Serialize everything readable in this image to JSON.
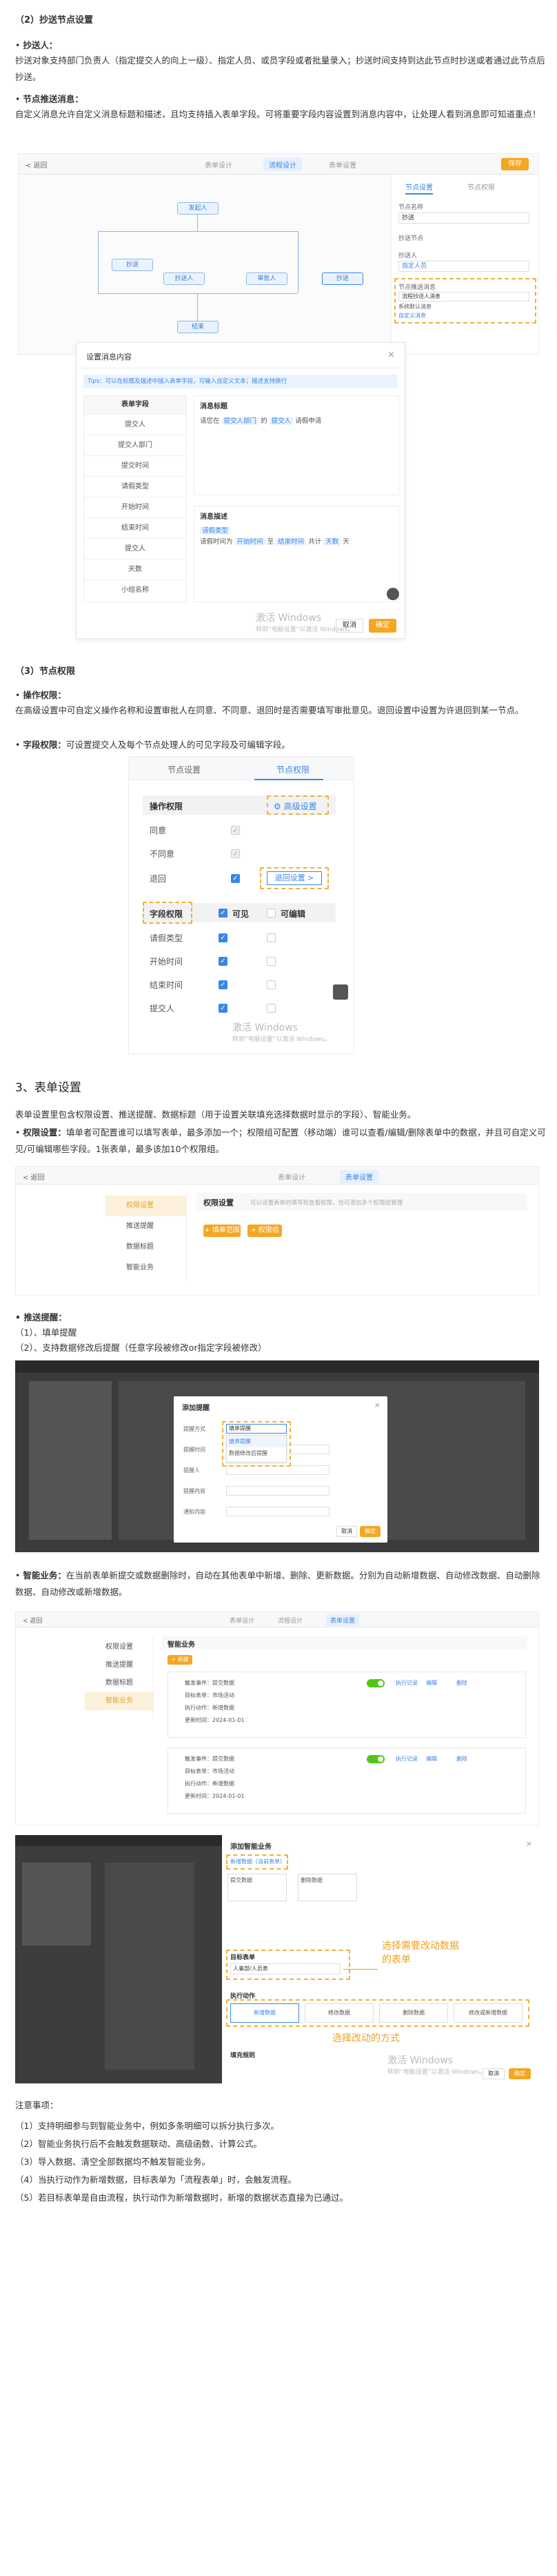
{
  "sec_copy": {
    "title": "（2）抄送节点设置",
    "cc_title": "抄送人：",
    "cc_text": "抄送对象支持部门负责人（指定提交人的向上一级）、指定人员、或员字段或者批量录入；抄送时间支持到达此节点时抄送或者通过此节点后抄送。",
    "push_title": "节点推送消息：",
    "push_text": "自定义消息允许自定义消息标题和描述，且均支持插入表单字段。可将重要字段内容设置到消息内容中，让处理人看到消息即可知道重点！"
  },
  "flow_shot": {
    "back": "< 返回",
    "tabs": [
      "表单设计",
      "流程设计",
      "表单设置"
    ],
    "save": "保存",
    "nodes": [
      "发起人",
      "抄送",
      "抄送人",
      "审批人",
      "结束"
    ],
    "panel_tabs": [
      "节点设置",
      "节点权限"
    ],
    "panel_labels": [
      "节点名称",
      "抄送节点",
      "抄送人",
      "节点推送消息"
    ],
    "panel_values": [
      "抄送",
      "添加",
      "指定人员",
      "流程抄送人消息"
    ],
    "options": [
      "系统默认消息",
      "自定义消息"
    ]
  },
  "msg_dialog": {
    "title": "设置消息内容",
    "tips": "Tips：可以在标题及描述中插入表单字段，可输入自定义文本；描述支持换行",
    "field_header": "表单字段",
    "fields": [
      "提交人",
      "提交人部门",
      "提交时间",
      "请假类型",
      "开始时间",
      "结束时间",
      "提交人",
      "天数",
      "小组名称"
    ],
    "title_label": "消息标题",
    "title_text_1": "请您在",
    "title_chip_1": "提交人部门",
    "title_text_2": "的",
    "title_chip_2": "提交人",
    "title_text_3": "请假申请",
    "desc_label": "消息描述",
    "desc_chip_1": "请假类型",
    "desc_text_1": "请假时间为",
    "desc_chip_2": "开始时间",
    "desc_text_2": "至",
    "desc_chip_3": "结束时间",
    "desc_text_3": "共计",
    "desc_chip_4": "天数",
    "desc_text_4": "天",
    "cancel": "取消",
    "ok": "确定"
  },
  "watermark": {
    "line1": "激活 Windows",
    "line2": "转到“电脑设置”以激活 Windows。"
  },
  "sec_node": {
    "title": "（3）节点权限",
    "op_title": "操作权限：",
    "op_text": "在高级设置中可自定义操作名称和设置审批人在同意、不同意、退回时是否需要填写审批意见。退回设置中设置为许退回到某一节点。",
    "field_title": "字段权限：",
    "field_text": "可设置提交人及每个节点处理人的可见字段及可编辑字段。"
  },
  "perm_shot": {
    "tabs": [
      "节点设置",
      "节点权限"
    ],
    "op_header": "操作权限",
    "adv": "高级设置",
    "ops": [
      "同意",
      "不同意",
      "退回"
    ],
    "back_setting": "退回设置 >",
    "field_header": "字段权限",
    "visible": "可见",
    "editable": "可编辑",
    "fields": [
      "请假类型",
      "开始时间",
      "结束时间",
      "提交人"
    ]
  },
  "sec_form": {
    "title": "3、表单设置",
    "intro": "表单设置里包含权限设置、推送提醒、数据标题（用于设置关联填充选择数据时显示的字段）、智能业务。",
    "perm_title": "权限设置：",
    "perm_text": "填单者可配置谁可以填写表单，最多添加一个；权限组可配置（移动端）谁可以查看/编辑/删除表单中的数据，并且可自定义可见/可编辑哪些字段。1张表单，最多该加10个权限组。"
  },
  "formset_shot": {
    "back": "< 返回",
    "tabs": [
      "表单设计",
      "表单设置"
    ],
    "side": [
      "权限设置",
      "推送提醒",
      "数据标题",
      "智能业务"
    ],
    "header": "权限设置",
    "hint": "可以设置表单的填写和查看权限，也可添加多个权限组管理",
    "btn1": "+ 填单范围",
    "btn2": "+ 权限组"
  },
  "sec_push": {
    "title": "推送提醒：",
    "items": [
      "（1）、填单提醒",
      "（2）、支持数据修改后提醒（任意字段被修改or指定字段被修改）"
    ]
  },
  "push_shot": {
    "dialog_title": "添加提醒",
    "labels": [
      "提醒方式",
      "提醒时间",
      "提醒人",
      "提醒内容",
      "通知内容"
    ],
    "select_value": "填单提醒",
    "options": [
      "填单提醒",
      "数据修改后提醒"
    ],
    "cancel": "取消",
    "ok": "确定"
  },
  "sec_smart": {
    "title": "智能业务：",
    "text": "在当前表单新提交或数据删除时，自动在其他表单中新增、删除、更新数据。分别为自动新增数据、自动修改数据、自动删除数据、自动修改或新增数据。"
  },
  "smart_shot": {
    "back": "< 返回",
    "tabs": [
      "表单设计",
      "流程设计",
      "表单设置"
    ],
    "side": [
      "权限设置",
      "推送提醒",
      "数据标题",
      "智能业务"
    ],
    "header": "智能业务",
    "add": "+ 新建",
    "card_lines": [
      "触发事件：提交数据",
      "目标表单：市场活动",
      "执行动作：新增数据",
      "更新时间：2024-01-01"
    ],
    "actions": [
      "执行记录",
      "编辑",
      "删除"
    ]
  },
  "smart_dialog": {
    "title": "添加智能业务",
    "tabs": [
      "新增数据（当前表单）",
      "提交数据",
      "删除数据"
    ],
    "target_label": "目标表单",
    "target_value": "人事部/人员表",
    "exec_label": "执行动作",
    "exec_opts": [
      "新增数据",
      "修改数据",
      "删除数据",
      "修改或新增数据"
    ],
    "field_label": "填充规则",
    "cap1": "选择需要改动数据\n的表单",
    "cap2": "选择改动的方式",
    "cancel": "取消",
    "ok": "确定"
  },
  "notes": {
    "title": "注意事项：",
    "items": [
      "（1）支持明细参与到智能业务中，例如多条明细可以拆分执行多次。",
      "（2）智能业务执行后不会触发数据联动、高级函数、计算公式。",
      "（3）导入数据、清空全部数据均不触发智能业务。",
      "（4）当执行动作为新增数据，目标表单为「流程表单」时，会触发流程。",
      "（5）若目标表单是自由流程，执行动作为新增数据时，新增的数据状态直接为已通过。"
    ]
  }
}
